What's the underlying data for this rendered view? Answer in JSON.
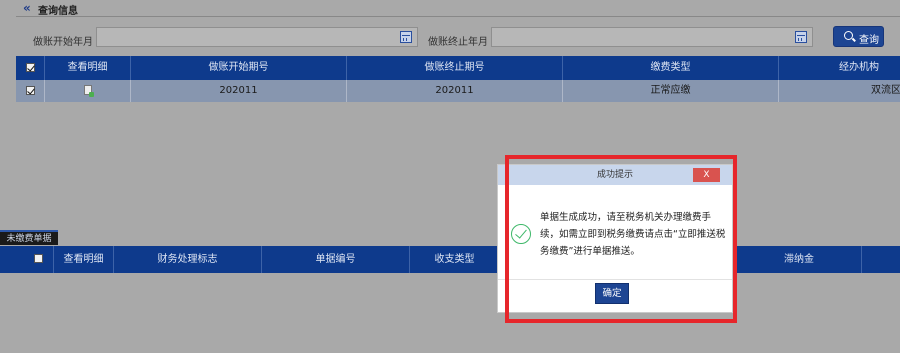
{
  "header": {
    "title": "查询信息"
  },
  "search": {
    "start_label": "做账开始年月",
    "end_label": "做账终止年月",
    "start_value": "",
    "end_value": "",
    "query_label": "查询"
  },
  "top_table": {
    "columns": [
      "查看明细",
      "做账开始期号",
      "做账终止期号",
      "缴费类型",
      "经办机构"
    ],
    "rows": [
      {
        "start": "202011",
        "end": "202011",
        "type": "正常应缴",
        "agency": "双流区"
      }
    ]
  },
  "bottom": {
    "tab_label": "未缴费单据",
    "columns": [
      "查看明细",
      "财务处理标志",
      "单据编号",
      "收支类型",
      "滞纳金"
    ]
  },
  "modal": {
    "title": "成功提示",
    "close_label": "X",
    "message": "单据生成成功，请至税务机关办理缴费手续，如需立即到税务缴费请点击“立即推送税务缴费”进行单据推送。",
    "ok_label": "确定"
  },
  "colors": {
    "header_blue": "#0e3a8c",
    "highlight_red": "#e6262b",
    "success_green": "#3fb86a",
    "close_red": "#d9534f"
  }
}
